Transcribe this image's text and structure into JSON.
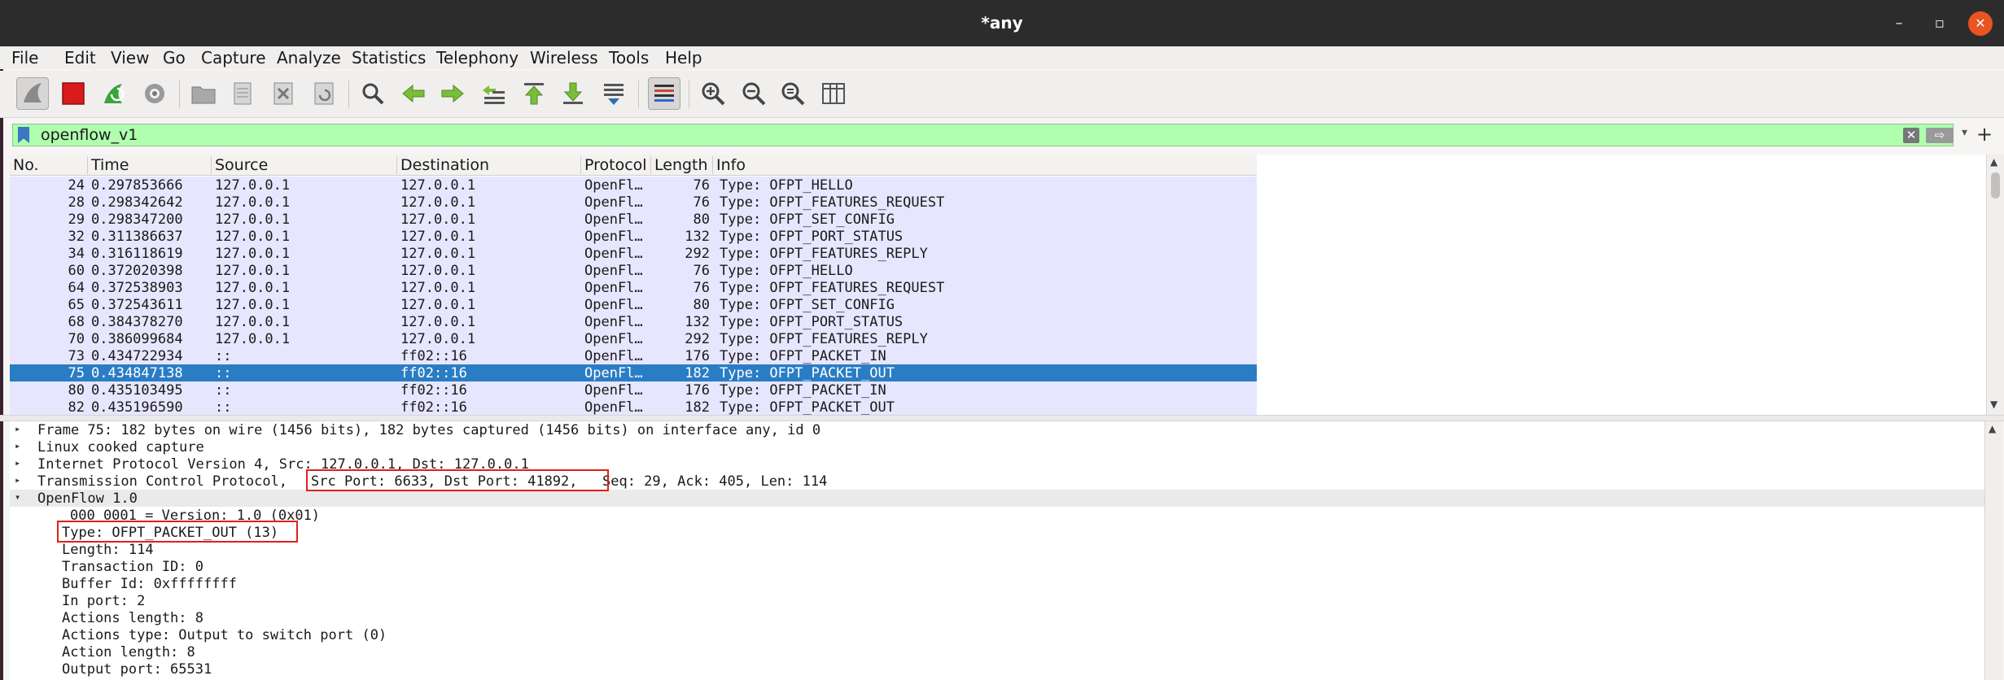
{
  "window": {
    "title": "*any",
    "minimize_glyph": "–",
    "maximize_glyph": "▫",
    "close_glyph": "✕"
  },
  "menu": {
    "items": [
      "File",
      "Edit",
      "View",
      "Go",
      "Capture",
      "Analyze",
      "Statistics",
      "Telephony",
      "Wireless",
      "Tools",
      "Help"
    ]
  },
  "toolbar": {
    "icons": [
      "shark-fin-start-icon",
      "stop-capture-icon",
      "restart-capture-icon",
      "capture-options-icon",
      "open-file-icon",
      "save-file-icon",
      "close-file-icon",
      "reload-file-icon",
      "find-packet-icon",
      "go-back-icon",
      "go-forward-icon",
      "go-to-packet-icon",
      "go-first-icon",
      "go-last-icon",
      "autoscroll-icon",
      "colorize-icon",
      "zoom-in-icon",
      "zoom-out-icon",
      "normal-size-icon",
      "resize-columns-icon"
    ],
    "colors": {
      "stop": "#d81b1b",
      "green": "#3aa33a",
      "blue": "#2f6db5"
    }
  },
  "filter": {
    "value": "openflow_v1",
    "clear_glyph": "✕",
    "apply_glyph": "⇨",
    "dropdown_glyph": "▾",
    "add_glyph": "+",
    "background": "#afffaf"
  },
  "packet_list": {
    "columns": [
      "No.",
      "Time",
      "Source",
      "Destination",
      "Protocol",
      "Length",
      "Info"
    ],
    "rows": [
      {
        "no": "24",
        "time": "0.297853666",
        "src": "127.0.0.1",
        "dst": "127.0.0.1",
        "proto": "OpenFl…",
        "len": "76",
        "info": "Type: OFPT_HELLO"
      },
      {
        "no": "28",
        "time": "0.298342642",
        "src": "127.0.0.1",
        "dst": "127.0.0.1",
        "proto": "OpenFl…",
        "len": "76",
        "info": "Type: OFPT_FEATURES_REQUEST"
      },
      {
        "no": "29",
        "time": "0.298347200",
        "src": "127.0.0.1",
        "dst": "127.0.0.1",
        "proto": "OpenFl…",
        "len": "80",
        "info": "Type: OFPT_SET_CONFIG"
      },
      {
        "no": "32",
        "time": "0.311386637",
        "src": "127.0.0.1",
        "dst": "127.0.0.1",
        "proto": "OpenFl…",
        "len": "132",
        "info": "Type: OFPT_PORT_STATUS"
      },
      {
        "no": "34",
        "time": "0.316118619",
        "src": "127.0.0.1",
        "dst": "127.0.0.1",
        "proto": "OpenFl…",
        "len": "292",
        "info": "Type: OFPT_FEATURES_REPLY"
      },
      {
        "no": "60",
        "time": "0.372020398",
        "src": "127.0.0.1",
        "dst": "127.0.0.1",
        "proto": "OpenFl…",
        "len": "76",
        "info": "Type: OFPT_HELLO"
      },
      {
        "no": "64",
        "time": "0.372538903",
        "src": "127.0.0.1",
        "dst": "127.0.0.1",
        "proto": "OpenFl…",
        "len": "76",
        "info": "Type: OFPT_FEATURES_REQUEST"
      },
      {
        "no": "65",
        "time": "0.372543611",
        "src": "127.0.0.1",
        "dst": "127.0.0.1",
        "proto": "OpenFl…",
        "len": "80",
        "info": "Type: OFPT_SET_CONFIG"
      },
      {
        "no": "68",
        "time": "0.384378270",
        "src": "127.0.0.1",
        "dst": "127.0.0.1",
        "proto": "OpenFl…",
        "len": "132",
        "info": "Type: OFPT_PORT_STATUS"
      },
      {
        "no": "70",
        "time": "0.386099684",
        "src": "127.0.0.1",
        "dst": "127.0.0.1",
        "proto": "OpenFl…",
        "len": "292",
        "info": "Type: OFPT_FEATURES_REPLY"
      },
      {
        "no": "73",
        "time": "0.434722934",
        "src": "::",
        "dst": "ff02::16",
        "proto": "OpenFl…",
        "len": "176",
        "info": "Type: OFPT_PACKET_IN"
      },
      {
        "no": "75",
        "time": "0.434847138",
        "src": "::",
        "dst": "ff02::16",
        "proto": "OpenFl…",
        "len": "182",
        "info": "Type: OFPT_PACKET_OUT"
      },
      {
        "no": "80",
        "time": "0.435103495",
        "src": "::",
        "dst": "ff02::16",
        "proto": "OpenFl…",
        "len": "176",
        "info": "Type: OFPT_PACKET_IN"
      },
      {
        "no": "82",
        "time": "0.435196590",
        "src": "::",
        "dst": "ff02::16",
        "proto": "OpenFl…",
        "len": "182",
        "info": "Type: OFPT_PACKET_OUT"
      }
    ],
    "selected_no": "75",
    "row_color": "#e7e6ff",
    "selected_color": "#2a7dc4"
  },
  "details": {
    "tcp_prefix": "Transmission Control Protocol,",
    "tcp_ports": "Src Port: 6633, Dst Port: 41892,",
    "tcp_suffix": "Seq: 29, Ack: 405, Len: 114",
    "lines": [
      {
        "text": "Frame 75: 182 bytes on wire (1456 bits), 182 bytes captured (1456 bits) on interface any, id 0",
        "twisty": "▸"
      },
      {
        "text": "Linux cooked capture",
        "twisty": "▸"
      },
      {
        "text": "Internet Protocol Version 4, Src: 127.0.0.1, Dst: 127.0.0.1",
        "twisty": "▸"
      },
      {
        "text": "",
        "twisty": "▸"
      },
      {
        "text": "OpenFlow 1.0",
        "twisty": "▾"
      },
      {
        "text": "000 0001 = Version: 1.0 (0x01)",
        "twisty": ""
      },
      {
        "text": "Type: OFPT_PACKET_OUT (13)",
        "twisty": ""
      },
      {
        "text": "Length: 114",
        "twisty": ""
      },
      {
        "text": "Transaction ID: 0",
        "twisty": ""
      },
      {
        "text": "Buffer Id: 0xffffffff",
        "twisty": ""
      },
      {
        "text": "In port: 2",
        "twisty": ""
      },
      {
        "text": "Actions length: 8",
        "twisty": ""
      },
      {
        "text": "Actions type: Output to switch port (0)",
        "twisty": ""
      },
      {
        "text": "Action length: 8",
        "twisty": ""
      },
      {
        "text": "Output port: 65531",
        "twisty": ""
      }
    ],
    "highlight_color": "#e0201a"
  },
  "scroll_glyphs": {
    "up": "▲",
    "down": "▼"
  }
}
